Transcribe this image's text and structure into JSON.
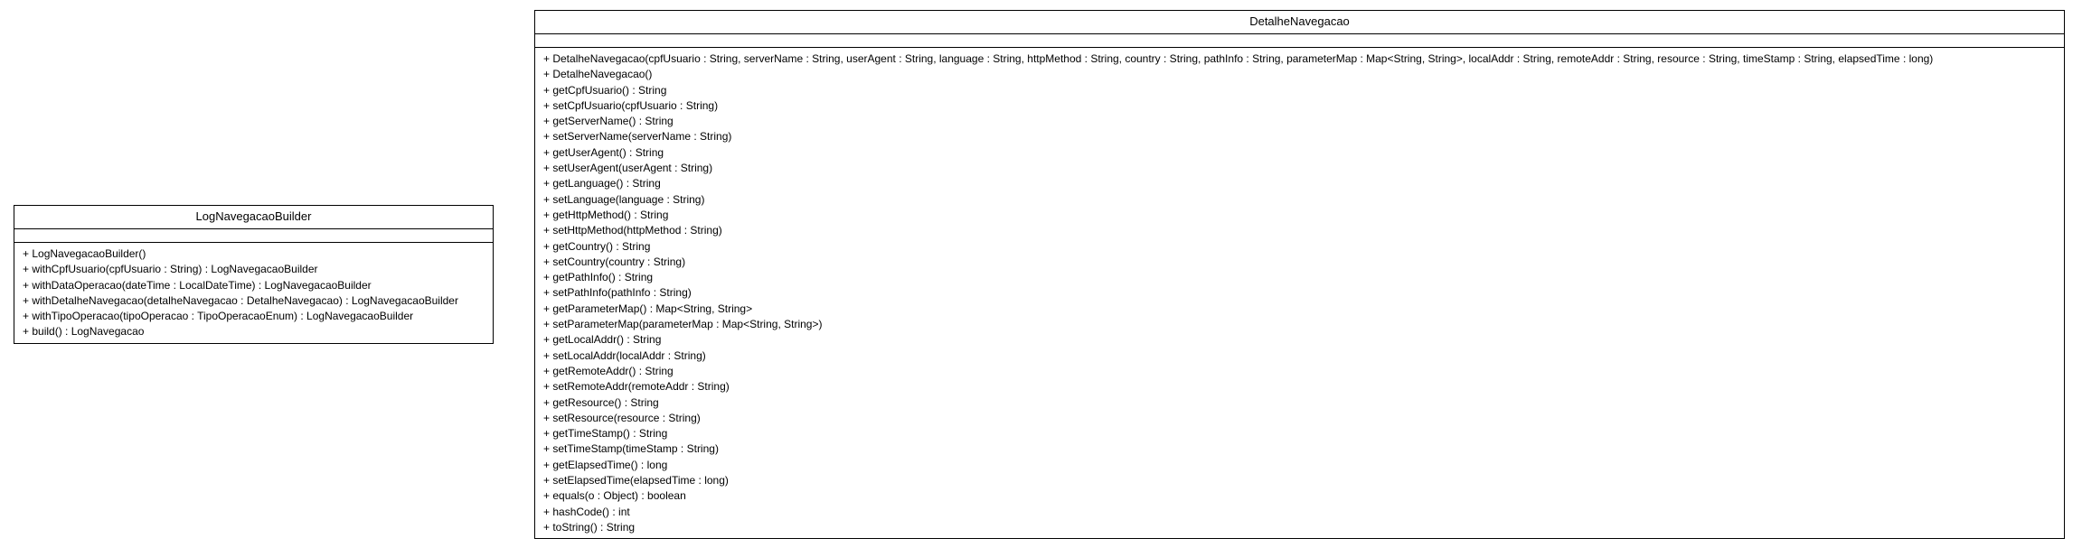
{
  "diagram": {
    "classes": [
      {
        "name": "LogNavegacaoBuilder",
        "attributes": [],
        "operations": [
          "+ LogNavegacaoBuilder()",
          "+ withCpfUsuario(cpfUsuario : String) : LogNavegacaoBuilder",
          "+ withDataOperacao(dateTime : LocalDateTime) : LogNavegacaoBuilder",
          "+ withDetalheNavegacao(detalheNavegacao : DetalheNavegacao) : LogNavegacaoBuilder",
          "+ withTipoOperacao(tipoOperacao : TipoOperacaoEnum) : LogNavegacaoBuilder",
          "+ build() : LogNavegacao"
        ]
      },
      {
        "name": "DetalheNavegacao",
        "attributes": [],
        "operations": [
          "+ DetalheNavegacao(cpfUsuario : String, serverName : String, userAgent : String, language : String, httpMethod : String, country : String, pathInfo : String, parameterMap : Map<String, String>, localAddr : String, remoteAddr : String, resource : String, timeStamp : String, elapsedTime : long)",
          "+ DetalheNavegacao()",
          "+ getCpfUsuario() : String",
          "+ setCpfUsuario(cpfUsuario : String)",
          "+ getServerName() : String",
          "+ setServerName(serverName : String)",
          "+ getUserAgent() : String",
          "+ setUserAgent(userAgent : String)",
          "+ getLanguage() : String",
          "+ setLanguage(language : String)",
          "+ getHttpMethod() : String",
          "+ setHttpMethod(httpMethod : String)",
          "+ getCountry() : String",
          "+ setCountry(country : String)",
          "+ getPathInfo() : String",
          "+ setPathInfo(pathInfo : String)",
          "+ getParameterMap() : Map<String, String>",
          "+ setParameterMap(parameterMap : Map<String, String>)",
          "+ getLocalAddr() : String",
          "+ setLocalAddr(localAddr : String)",
          "+ getRemoteAddr() : String",
          "+ setRemoteAddr(remoteAddr : String)",
          "+ getResource() : String",
          "+ setResource(resource : String)",
          "+ getTimeStamp() : String",
          "+ setTimeStamp(timeStamp : String)",
          "+ getElapsedTime() : long",
          "+ setElapsedTime(elapsedTime : long)",
          "+ equals(o : Object) : boolean",
          "+ hashCode() : int",
          "+ toString() : String"
        ]
      }
    ]
  }
}
